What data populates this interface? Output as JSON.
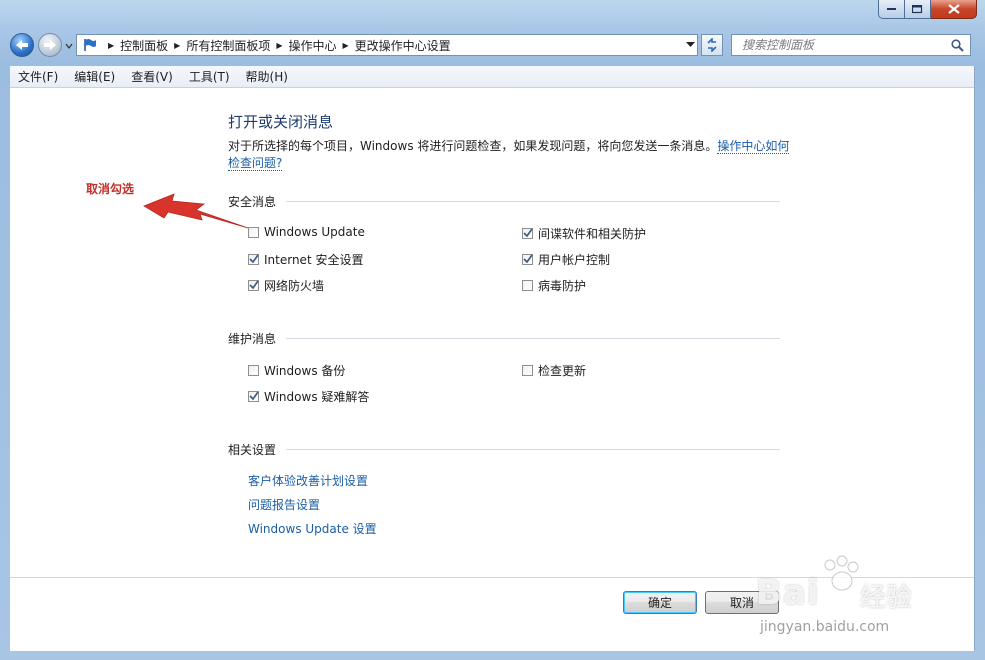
{
  "window": {
    "caption_buttons": [
      "minimize",
      "maximize",
      "close"
    ]
  },
  "address_bar": {
    "breadcrumbs": [
      "控制面板",
      "所有控制面板项",
      "操作中心",
      "更改操作中心设置"
    ]
  },
  "search": {
    "placeholder": "搜索控制面板"
  },
  "menu": {
    "items": [
      "文件(F)",
      "编辑(E)",
      "查看(V)",
      "工具(T)",
      "帮助(H)"
    ]
  },
  "content": {
    "title": "打开或关闭消息",
    "description": "对于所选择的每个项目，Windows 将进行问题检查，如果发现问题，将向您发送一条消息。",
    "description_link": "操作中心如何检查问题?",
    "sections": {
      "security": {
        "label": "安全消息",
        "items": [
          {
            "label": "Windows Update",
            "checked": false
          },
          {
            "label": "间谍软件和相关防护",
            "checked": true
          },
          {
            "label": "Internet 安全设置",
            "checked": true
          },
          {
            "label": "用户帐户控制",
            "checked": true
          },
          {
            "label": "网络防火墙",
            "checked": true
          },
          {
            "label": "病毒防护",
            "checked": false
          }
        ]
      },
      "maintenance": {
        "label": "维护消息",
        "items": [
          {
            "label": "Windows 备份",
            "checked": false
          },
          {
            "label": "检查更新",
            "checked": false
          },
          {
            "label": "Windows 疑难解答",
            "checked": true
          }
        ]
      },
      "related": {
        "label": "相关设置",
        "links": [
          "客户体验改善计划设置",
          "问题报告设置",
          "Windows Update 设置"
        ]
      }
    },
    "annotation": "取消勾选"
  },
  "buttons": {
    "ok": "确定",
    "cancel": "取消"
  },
  "watermark": {
    "brand": "Bai",
    "brand_cn": "经验",
    "url": "jingyan.baidu.com"
  },
  "colors": {
    "link": "#1a5ea8",
    "title": "#1f3c6e",
    "annotation": "#c0312b",
    "frame": "#a9c7e6"
  }
}
